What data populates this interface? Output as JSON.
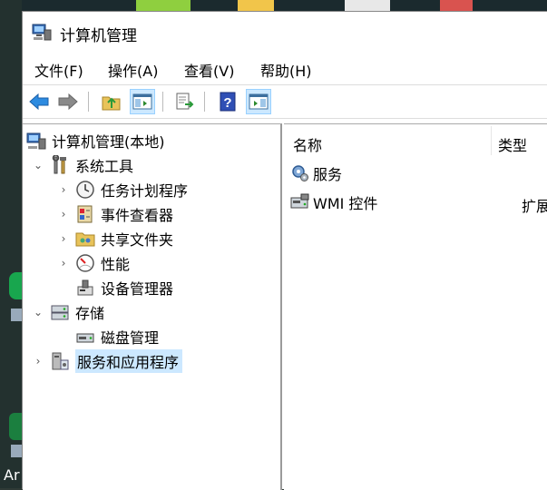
{
  "window": {
    "title": "计算机管理"
  },
  "menu": [
    "文件(F)",
    "操作(A)",
    "查看(V)",
    "帮助(H)"
  ],
  "toolbar": {
    "buttons": [
      "back-icon",
      "forward-icon",
      "up-folder-icon",
      "show-hide-console-tree-icon",
      "export-list-icon",
      "help-icon",
      "show-hide-action-pane-icon"
    ]
  },
  "tree": {
    "root": "计算机管理(本地)",
    "system_tools": "系统工具",
    "task_scheduler": "任务计划程序",
    "event_viewer": "事件查看器",
    "shared_folders": "共享文件夹",
    "performance": "性能",
    "device_manager": "设备管理器",
    "storage": "存储",
    "disk_management": "磁盘管理",
    "services_apps": "服务和应用程序"
  },
  "list": {
    "col_name": "名称",
    "col_type": "类型",
    "rows": [
      {
        "name": "服务",
        "type": ""
      },
      {
        "name": "WMI 控件",
        "type": "扩展管"
      }
    ]
  },
  "desktop": {
    "label": "Ar"
  }
}
